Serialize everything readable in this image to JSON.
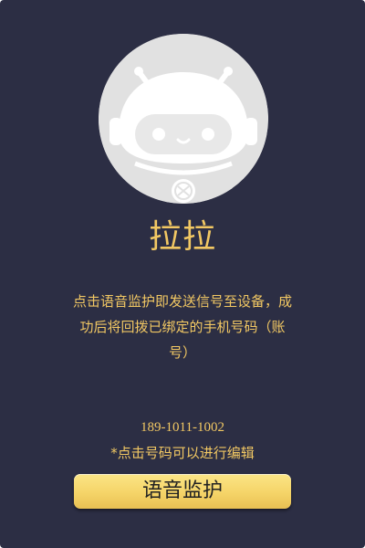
{
  "contact": {
    "name": "拉拉",
    "avatar_icon": "robot-avatar-icon"
  },
  "description": "点击语音监护即发送信号至设备，成功后将回拨已绑定的手机号码（账号）",
  "phone": {
    "number": "189-1011-1002",
    "hint": "*点击号码可以进行编辑"
  },
  "button": {
    "label": "语音监护"
  },
  "colors": {
    "background": "#2c2e44",
    "accent_text": "#f2c863",
    "button": "#f5d468",
    "avatar_bg": "#e1e1e1"
  }
}
